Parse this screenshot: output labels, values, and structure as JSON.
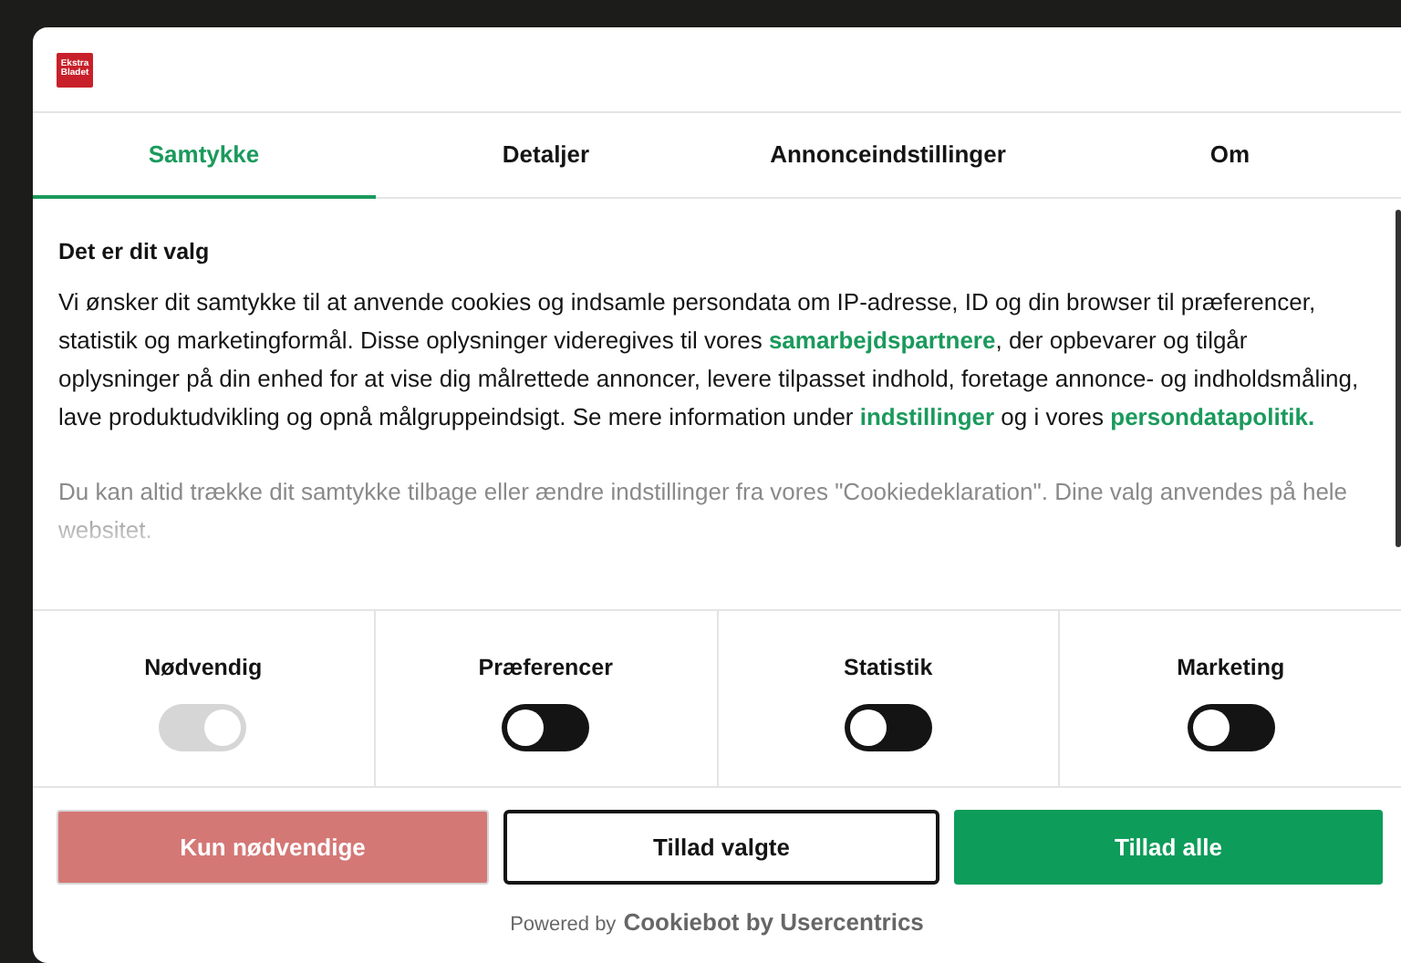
{
  "logo": {
    "lines": [
      "Ekstra",
      "Bladet"
    ]
  },
  "tabs": [
    {
      "label": "Samtykke",
      "selected": true
    },
    {
      "label": "Detaljer",
      "selected": false
    },
    {
      "label": "Annonceindstillinger",
      "selected": false
    },
    {
      "label": "Om",
      "selected": false
    }
  ],
  "heading": "Det er dit valg",
  "intro": [
    {
      "kind": "text",
      "text": "Vi ønsker dit samtykke til at anvende cookies og indsamle persondata om IP-adresse, ID og din browser til præferencer, statistik og marketingformål. Disse oplysninger videregives til vores "
    },
    {
      "kind": "link",
      "text": "samarbejdspartnere"
    },
    {
      "kind": "text",
      "text": ", der opbevarer og tilgår oplysninger på din enhed for at vise dig målrettede annoncer, levere tilpasset indhold, foretage annonce- og indholdsmåling, lave produktudvikling og opnå målgruppeindsigt. Se mere information under "
    },
    {
      "kind": "link",
      "text": "indstillinger"
    },
    {
      "kind": "text",
      "text": " og i vores "
    },
    {
      "kind": "link",
      "text": "persondatapolitik."
    }
  ],
  "note": "Du kan altid trække dit samtykke tilbage eller ændre indstillinger fra vores \"Cookiedeklaration\". Dine valg anvendes på hele websitet.",
  "categories": [
    {
      "label": "Nødvendig",
      "checked": true,
      "disabled": true
    },
    {
      "label": "Præferencer",
      "checked": false,
      "disabled": false
    },
    {
      "label": "Statistik",
      "checked": false,
      "disabled": false
    },
    {
      "label": "Marketing",
      "checked": false,
      "disabled": false
    }
  ],
  "buttons": [
    {
      "kind": "decline",
      "label": "Kun nødvendige"
    },
    {
      "kind": "outline",
      "label": "Tillad valgte"
    },
    {
      "kind": "accept",
      "label": "Tillad alle"
    }
  ],
  "footer": {
    "prefix": "Powered by",
    "brand": "Cookiebot by Usercentrics"
  }
}
